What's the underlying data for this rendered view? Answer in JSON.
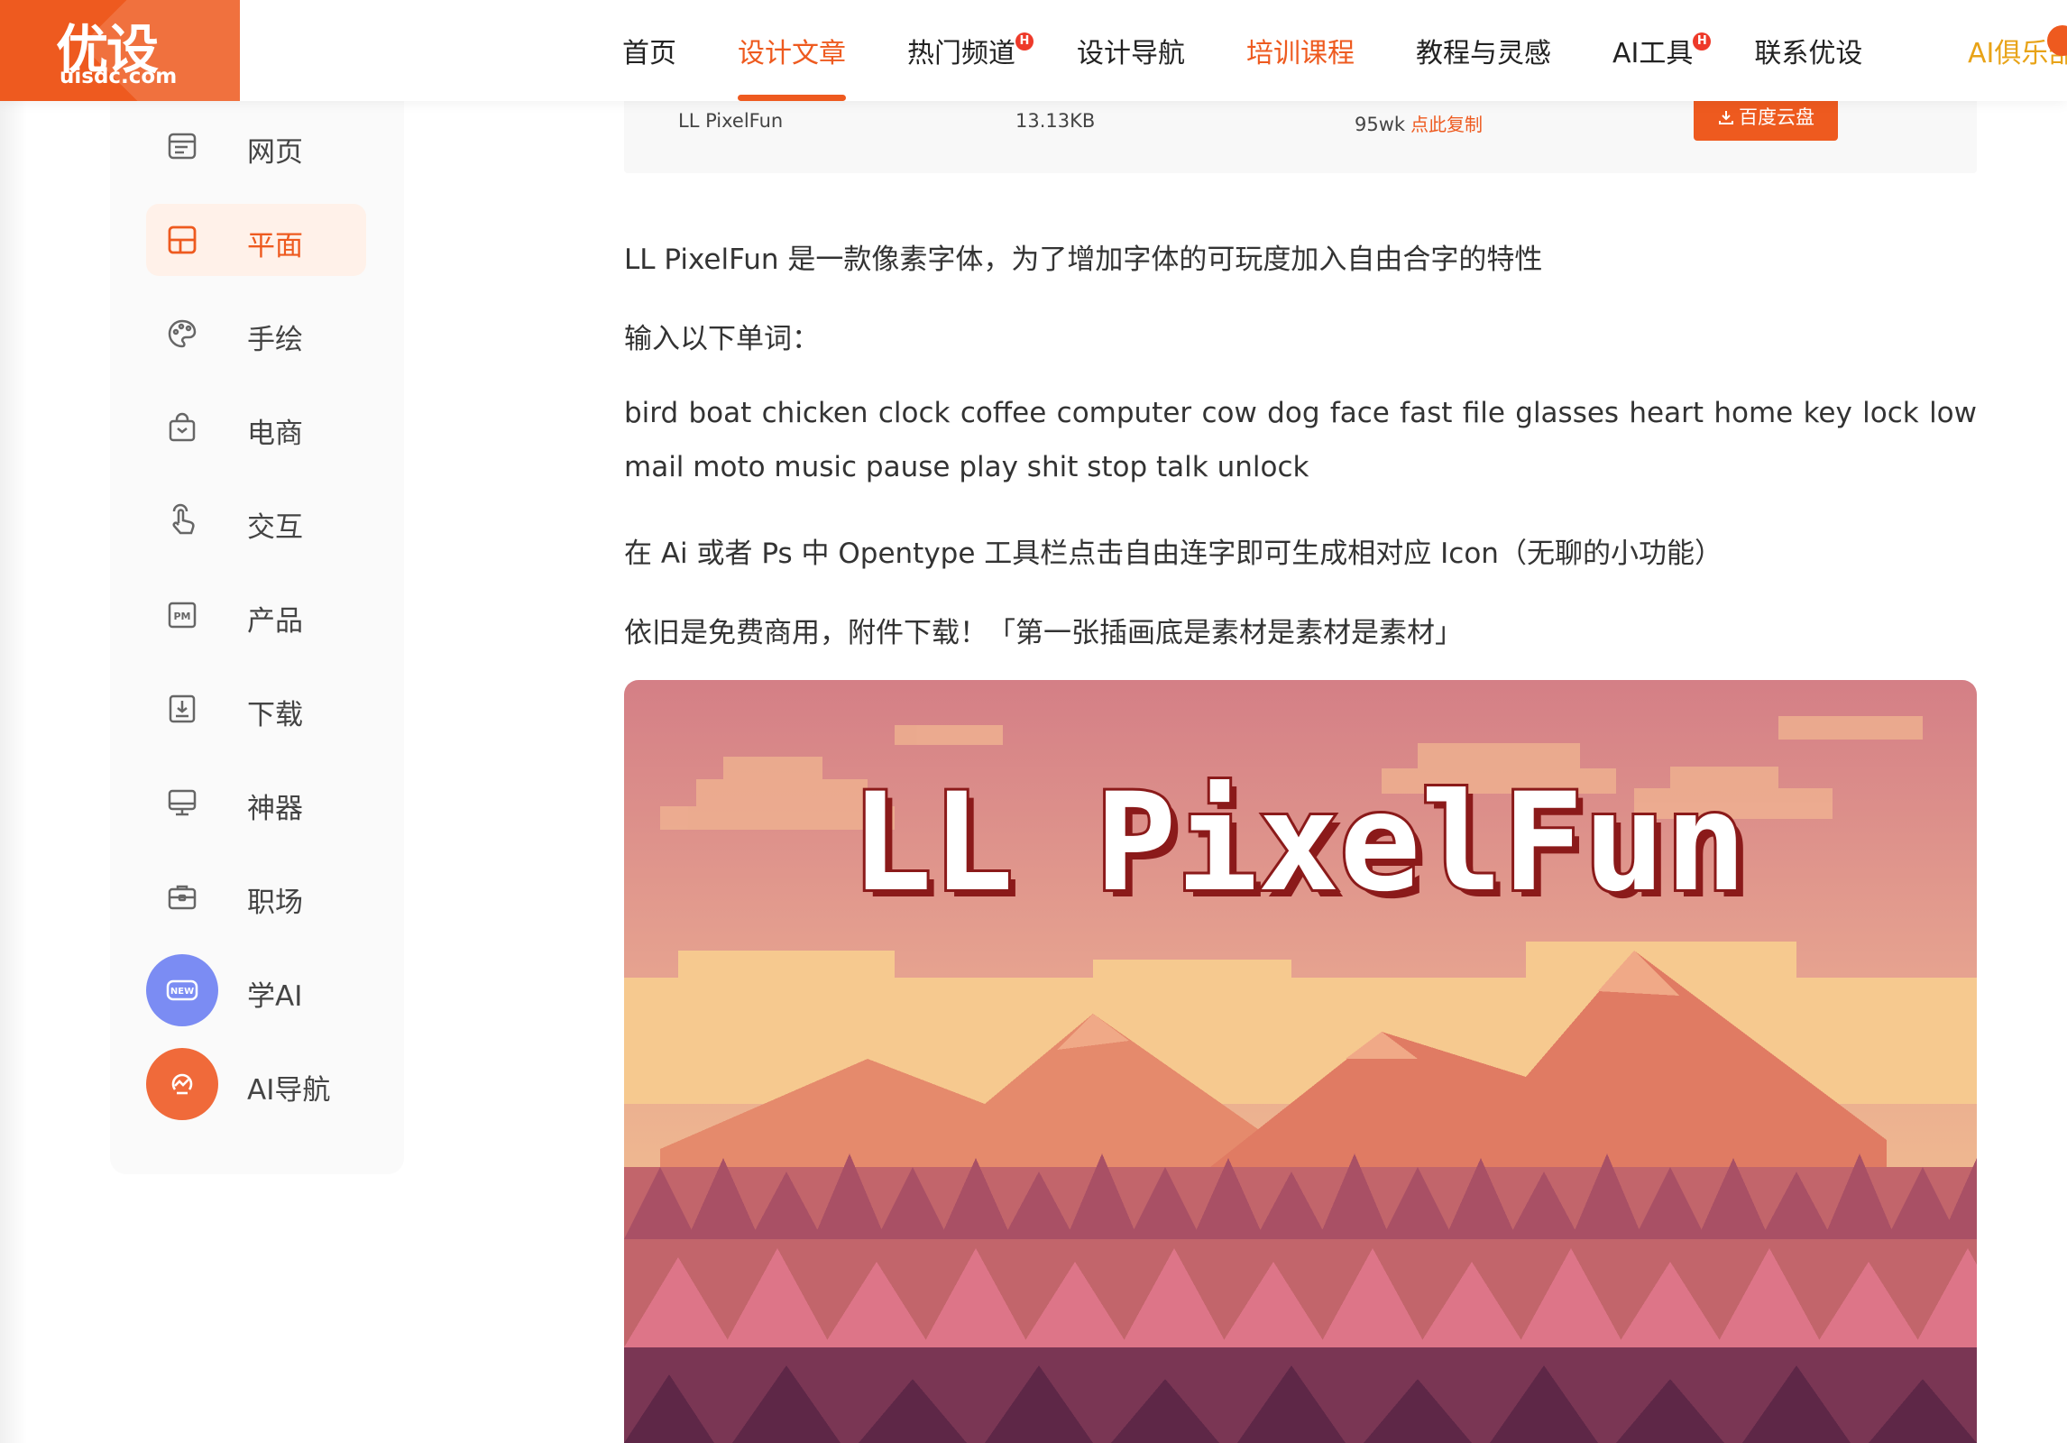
{
  "logo": {
    "main": "优设",
    "sub": "uisdc.com"
  },
  "nav": {
    "items": [
      {
        "label": "首页"
      },
      {
        "label": "设计文章"
      },
      {
        "label": "热门频道"
      },
      {
        "label": "设计导航"
      },
      {
        "label": "培训课程"
      },
      {
        "label": "教程与灵感"
      },
      {
        "label": "AI工具"
      },
      {
        "label": "联系优设"
      }
    ],
    "hot_badge": "H",
    "club": "AI俱乐部"
  },
  "sidebar": {
    "items": [
      {
        "label": "网页",
        "icon": "webpage-icon"
      },
      {
        "label": "平面",
        "icon": "layout-icon"
      },
      {
        "label": "手绘",
        "icon": "palette-icon"
      },
      {
        "label": "电商",
        "icon": "shopping-bag-icon"
      },
      {
        "label": "交互",
        "icon": "hand-pointer-icon"
      },
      {
        "label": "产品",
        "icon": "pm-icon"
      },
      {
        "label": "下载",
        "icon": "download-icon"
      },
      {
        "label": "神器",
        "icon": "monitor-icon"
      },
      {
        "label": "职场",
        "icon": "briefcase-icon"
      },
      {
        "label": "学AI",
        "icon": "new-badge-icon"
      },
      {
        "label": "AI导航",
        "icon": "ai-nav-icon"
      }
    ],
    "new_badge": "NEW"
  },
  "download": {
    "name": "LL PixelFun",
    "size": "13.13KB",
    "code": "95wk",
    "copy": "点此复制",
    "button": "百度云盘"
  },
  "article": {
    "p1": "LL PixelFun 是一款像素字体，为了增加字体的可玩度加入自由合字的特性",
    "p2": "输入以下单词：",
    "p3": "bird boat chicken clock coffee computer cow dog face fast file glasses heart home key lock low mail moto music pause play shit stop talk unlock",
    "p4": "在 Ai 或者 Ps 中 Opentype 工具栏点击自由连字即可生成相对应 Icon（无聊的小功能）",
    "p5": "依旧是免费商用，附件下载！「第一张插画底是素材是素材是素材」"
  },
  "hero": {
    "title": "LL PixelFun",
    "colors": {
      "sky_top": "#d47f86",
      "sky_bottom": "#f3c48e",
      "mountain": "#d97260",
      "forest": "#b2566a",
      "title_fill": "#ffffff",
      "title_outline": "#8b1a1a"
    }
  },
  "colors": {
    "accent": "#ee5a1f",
    "club": "#e8a317"
  }
}
